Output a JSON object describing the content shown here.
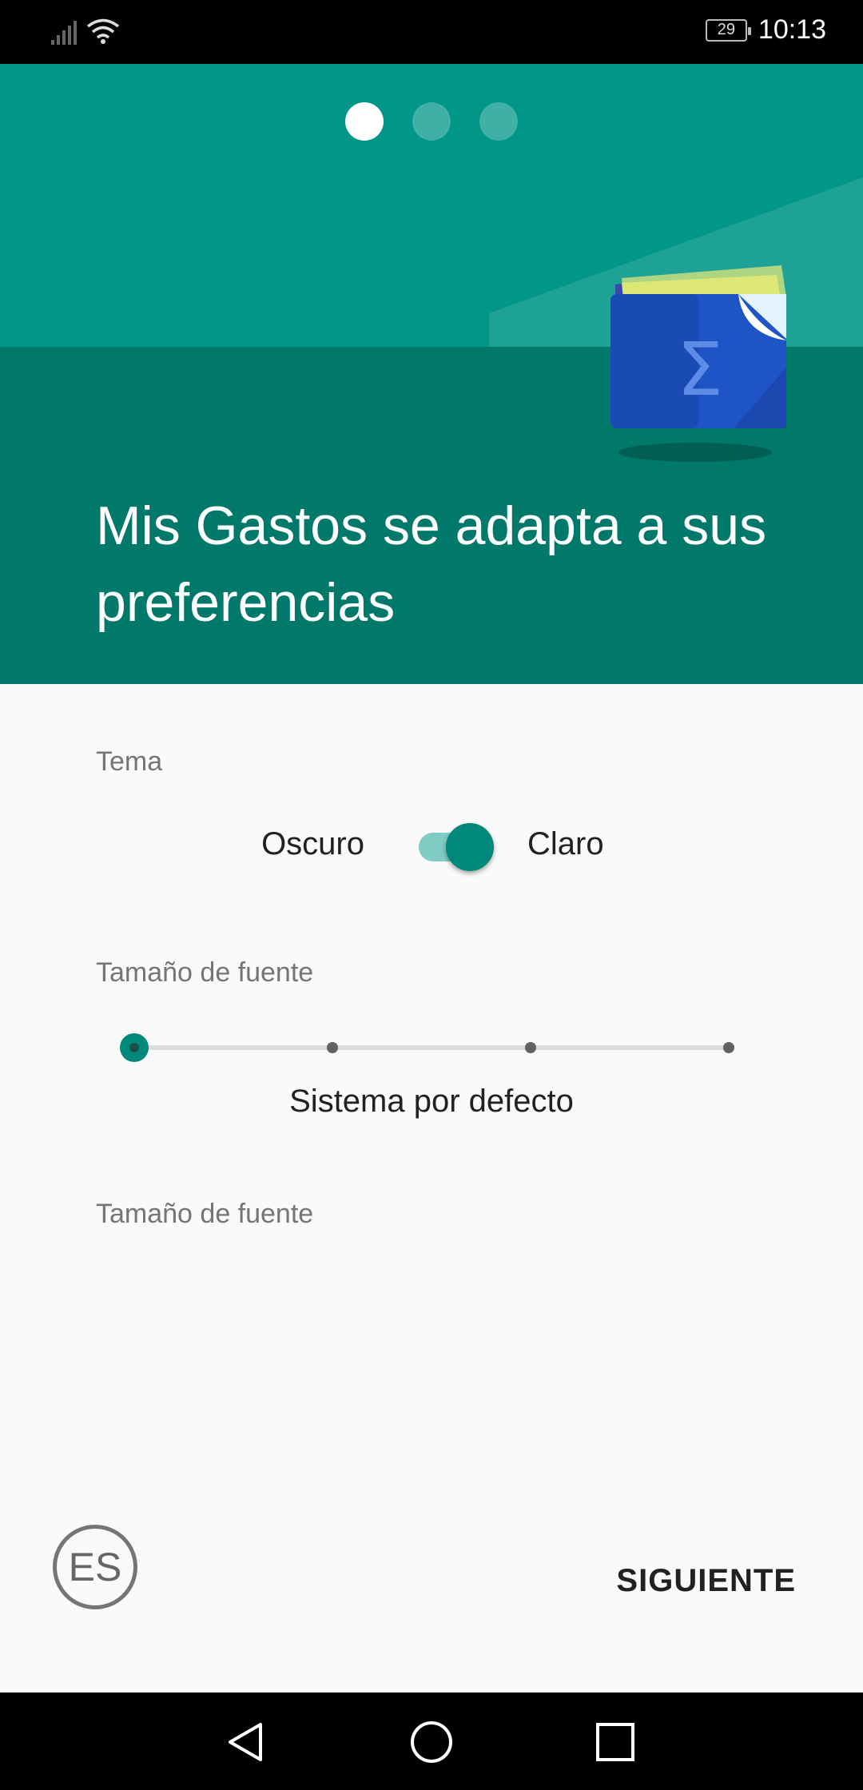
{
  "status_bar": {
    "battery_level": "29",
    "time": "10:13",
    "icons": [
      "signal-icon",
      "wifi-icon",
      "battery-icon"
    ]
  },
  "onboarding": {
    "page_indicator": {
      "total": 3,
      "active": 1
    },
    "illustration": "wallet-sigma-icon",
    "title": "Mis Gastos se adapta a sus preferencias"
  },
  "theme": {
    "label": "Tema",
    "option_dark": "Oscuro",
    "option_light": "Claro",
    "selected": "Claro"
  },
  "font_size": {
    "label": "Tamaño de fuente",
    "steps": 4,
    "selected_index": 0,
    "value_text": "Sistema por defecto"
  },
  "font_size_second": {
    "label": "Tamaño de fuente"
  },
  "footer": {
    "language_label": "ES",
    "next_label": "SIGUIENTE"
  },
  "nav_bar": {
    "buttons": [
      "back-icon",
      "home-icon",
      "recents-icon"
    ]
  },
  "colors": {
    "header_top": "#009688",
    "header_bottom": "#00796b",
    "accent": "#00897b",
    "accent_light": "#80cbc4",
    "background": "#fafafa"
  }
}
